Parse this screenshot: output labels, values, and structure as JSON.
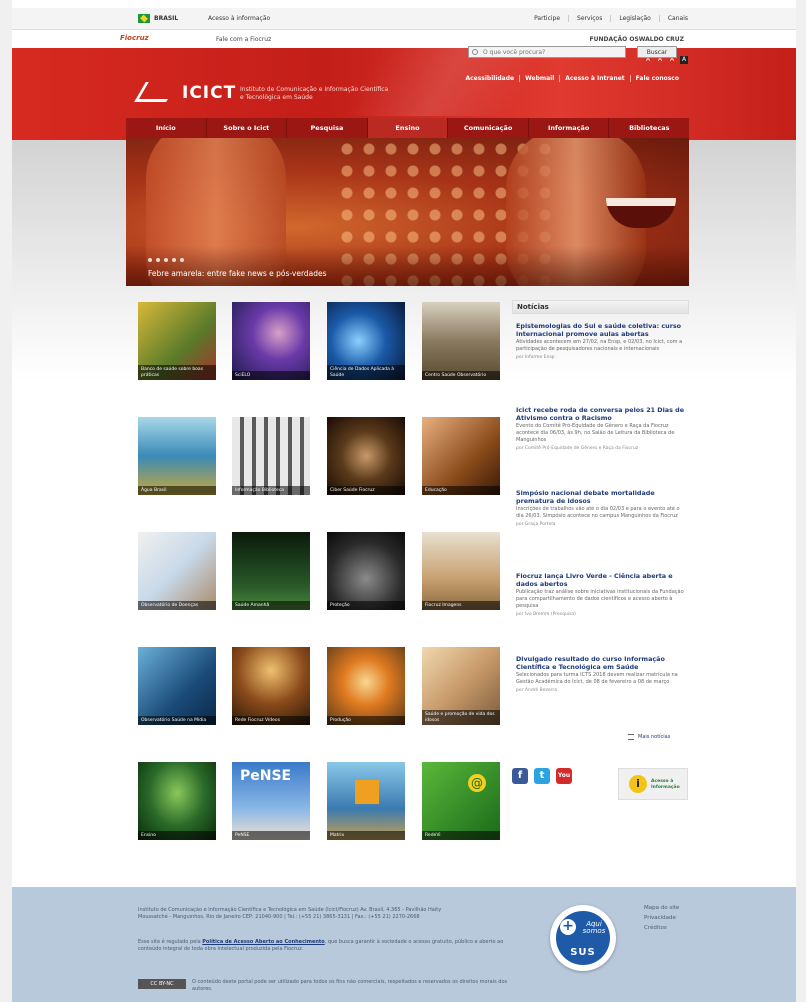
{
  "govbar": {
    "country": "BRASIL",
    "access": "Acesso à informação",
    "links": [
      "Participe",
      "Serviços",
      "Legislação",
      "Canais"
    ]
  },
  "subbar": {
    "logo": "Fiocruz",
    "fale": "Fale com a Fiocruz",
    "fundacao": "FUNDAÇÃO OSWALDO CRUZ"
  },
  "header": {
    "logo": "ICICT",
    "subtitle": "Instituto de Comunicação e Informação Científica e Tecnológica em Saúde",
    "font_controls": [
      "A",
      "A",
      "A"
    ],
    "util_links": [
      "Acessibilidade",
      "Webmail",
      "Acesso à Intranet",
      "Fale conosco"
    ],
    "search_placeholder": "O que você procura?",
    "search_button": "Buscar"
  },
  "nav": {
    "items": [
      "Início",
      "Sobre o Icict",
      "Pesquisa",
      "Ensino",
      "Comunicação",
      "Informação",
      "Bibliotecas"
    ]
  },
  "hero": {
    "caption": "Febre amarela: entre fake news e pós-verdades"
  },
  "tiles": [
    {
      "label": "Banco de saúde sobre boas práticas",
      "bg": "#b99a2a"
    },
    {
      "label": "SciELO",
      "bg": "#3a2b6e"
    },
    {
      "label": "Ciência de Dados Aplicada à Saúde",
      "bg": "#1a4d86"
    },
    {
      "label": "Centro Saúde Observatório",
      "bg": "#7a6a50"
    },
    {
      "label": "Água Brasil",
      "bg": "#3f8aa8"
    },
    {
      "label": "Informação Biblioteca",
      "bg": "#8a8a8a"
    },
    {
      "label": "Ciber Saúde Fiocruz",
      "bg": "#3a1f10"
    },
    {
      "label": "Educação",
      "bg": "#8a4a20"
    },
    {
      "label": "Observatório de Doenças",
      "bg": "#c8c8c8"
    },
    {
      "label": "Saúde Amanhã",
      "bg": "#1c3a1a"
    },
    {
      "label": "Proteção",
      "bg": "#2a2a2a"
    },
    {
      "label": "Fiocruz Imagens",
      "bg": "#b8b0a0"
    },
    {
      "label": "Observatório Saúde na Mídia",
      "bg": "#2a5a86"
    },
    {
      "label": "Rede Fiocruz Vídeos",
      "bg": "#6a3a20"
    },
    {
      "label": "Produção",
      "bg": "#c87a30"
    },
    {
      "label": "Saúde e promoção de vida dos idosos",
      "bg": "#c8a070"
    },
    {
      "label": "Ensino",
      "bg": "#1a3a1a"
    },
    {
      "label": "PeNSE",
      "bg": "#2a6ab0"
    },
    {
      "label": "Matrix",
      "bg": "#4a8ab8"
    },
    {
      "label": "RedeVi",
      "bg": "#2a8a2a"
    }
  ],
  "news": {
    "header": "Notícias",
    "items": [
      {
        "title": "Epistemologias do Sul e saúde coletiva: curso internacional promove aulas abertas",
        "body": "Atividades acontecem em 27/02, na Ensp, e 02/03, no Icict, com a participação de pesquisadores nacionais e internacionais",
        "source": "por Informe Ensp"
      },
      {
        "title": "Icict recebe roda de conversa pelos 21 Dias de Ativismo contra o Racismo",
        "body": "Evento do Comitê Pró-Equidade de Gênero e Raça da Fiocruz acontece dia 06/03, às 9h, no Salão de Leitura da Biblioteca de Manguinhos",
        "source": "por Comitê Pró-Equidade de Gênero e Raça da Fiocruz"
      },
      {
        "title": "Simpósio nacional debate mortalidade prematura de idosos",
        "body": "Inscrições de trabalhos vão até o dia 02/03 e para o evento até o dia 26/03. Simpósio acontece no campus Manguinhos da Fiocruz",
        "source": "por Graça Portela"
      },
      {
        "title": "Fiocruz lança Livro Verde - Ciência aberta e dados abertos",
        "body": "Publicação traz análise sobre iniciativas institucionais da Fundação para compartilhamento de dados científicos e acesso aberto à pesquisa",
        "source": "por Ivo Bremm (Presquisa)"
      },
      {
        "title": "Divulgado resultado do curso Informação Científica e Tecnológica em Saúde",
        "body": "Selecionados para turma ICTS 2018 devem realizar matrícula na Gestão Acadêmica do Icict, de 08 de fevereiro a 08 de março",
        "source": "por André Bezerra"
      }
    ],
    "more": "Mais notícias"
  },
  "social": {
    "facebook": "f",
    "twitter": "t",
    "youtube": "You",
    "acesso_info": "Acesso à Informação"
  },
  "footer": {
    "address": "Instituto de Comunicação e Informação Científica e Tecnológica em Saúde (Icict/Fiocruz) Av. Brasil, 4.365 - Pavilhão Haity Moussatché - Manguinhos, Rio de Janeiro CEP: 21040-900 | Tel.: (+55 21) 3865-3131 | Fax.: (+55 21) 2270-2668",
    "policy_prefix": "Esse site é regulado pela",
    "policy_link": "Política de Acesso Aberto ao Conhecimento",
    "policy_suffix": ", que busca garantir à sociedade o acesso gratuito, público e aberto ao conteúdo integral de toda obra intelectual produzida pela Fiocruz.",
    "cc_badge": "CC BY-NC",
    "license": "O conteúdo deste portal pode ser utilizado para todos os fins não comerciais, respeitados e reservados os direitos morais dos autores.",
    "sus_aqui": "Aqui somos",
    "sus": "SUS",
    "links": [
      "Mapa do site",
      "Privacidade",
      "Créditos"
    ]
  }
}
